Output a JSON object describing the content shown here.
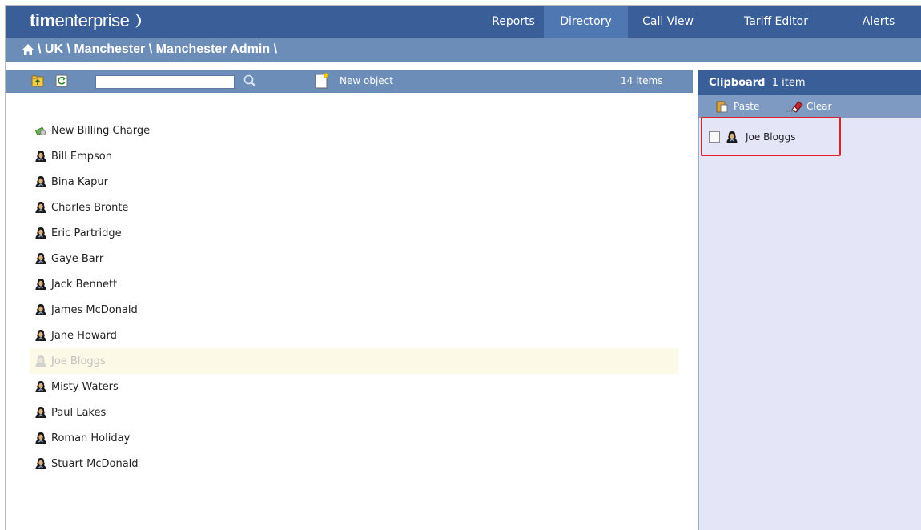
{
  "app": {
    "brand_bold": "tim",
    "brand_rest": "enterprise"
  },
  "nav": [
    {
      "label": "Reports",
      "active": false
    },
    {
      "label": "Directory",
      "active": true
    },
    {
      "label": "Call View",
      "active": false
    },
    {
      "label": "Tariff Editor",
      "active": false
    },
    {
      "label": "Alerts",
      "active": false
    }
  ],
  "breadcrumb": {
    "text": "\\ UK \\ Manchester \\ Manchester Admin \\"
  },
  "toolbar": {
    "search_value": "",
    "new_object_label": "New object",
    "item_count": "14 items",
    "icons": [
      "folder-up-icon",
      "refresh-icon",
      "search-icon",
      "new-object-icon"
    ]
  },
  "directory": {
    "items": [
      {
        "label": "New Billing Charge",
        "icon": "billing-charge-icon",
        "faded": false
      },
      {
        "label": "Bill Empson",
        "icon": "person-icon",
        "faded": false
      },
      {
        "label": "Bina Kapur",
        "icon": "person-icon",
        "faded": false
      },
      {
        "label": "Charles Bronte",
        "icon": "person-icon",
        "faded": false
      },
      {
        "label": "Eric Partridge",
        "icon": "person-icon",
        "faded": false
      },
      {
        "label": "Gaye Barr",
        "icon": "person-icon",
        "faded": false
      },
      {
        "label": "Jack Bennett",
        "icon": "person-icon",
        "faded": false
      },
      {
        "label": "James McDonald",
        "icon": "person-icon",
        "faded": false
      },
      {
        "label": "Jane Howard",
        "icon": "person-icon",
        "faded": false
      },
      {
        "label": "Joe Bloggs",
        "icon": "person-icon",
        "faded": true
      },
      {
        "label": "Misty Waters",
        "icon": "person-icon",
        "faded": false
      },
      {
        "label": "Paul Lakes",
        "icon": "person-icon",
        "faded": false
      },
      {
        "label": "Roman Holiday",
        "icon": "person-icon",
        "faded": false
      },
      {
        "label": "Stuart McDonald",
        "icon": "person-icon",
        "faded": false
      }
    ]
  },
  "clipboard": {
    "title": "Clipboard",
    "count": "1 item",
    "paste_label": "Paste",
    "clear_label": "Clear",
    "items": [
      {
        "label": "Joe Bloggs",
        "checked": false
      }
    ]
  },
  "colors": {
    "header": "#3a5f98",
    "nav_active": "#4f78b2",
    "subbar": "#6d8db9",
    "clipboard_bg": "#e5e5f8",
    "highlight": "#e0202a"
  }
}
